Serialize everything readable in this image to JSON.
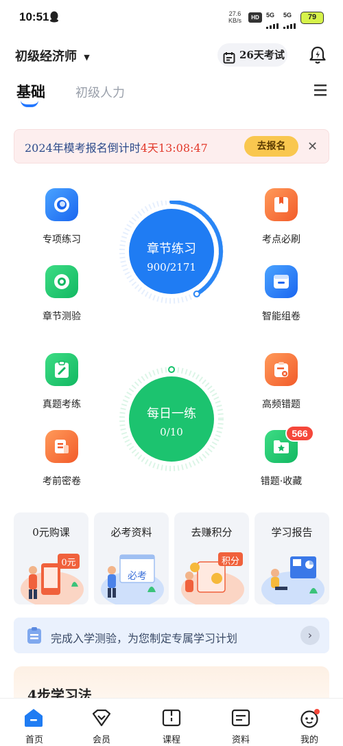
{
  "status_bar": {
    "time": "10:51",
    "net_speed_value": "27.6",
    "net_speed_unit": "KB/s",
    "signal1": "5G",
    "signal2": "5G",
    "battery": "79"
  },
  "header": {
    "exam_name": "初级经济师",
    "exam_days": "26天考试",
    "tabs": [
      "基础",
      "初级人力"
    ]
  },
  "banner": {
    "prefix": "2024年模考报名倒计时",
    "countdown": "4天13:08:47",
    "button": "去报名"
  },
  "features": {
    "left_top": [
      "专项练习",
      "章节测验"
    ],
    "right_top": [
      "考点必刷",
      "智能组卷"
    ],
    "left_bottom": [
      "真题考练",
      "考前密卷"
    ],
    "right_bottom": [
      "高频错题",
      "错题·收藏"
    ],
    "badge_count": "566"
  },
  "circles": {
    "chapter": {
      "title": "章节练习",
      "progress": "900/2171",
      "done": 900,
      "total": 2171
    },
    "daily": {
      "title": "每日一练",
      "progress": "0/10",
      "done": 0,
      "total": 10
    }
  },
  "cards": [
    {
      "title": "0元购课",
      "tag": "0元"
    },
    {
      "title": "必考资料",
      "tag": "必考"
    },
    {
      "title": "去赚积分",
      "tag": "积分"
    },
    {
      "title": "学习报告",
      "tag": ""
    }
  ],
  "assessment": {
    "text": "完成入学测验，为您制定专属学习计划"
  },
  "method": {
    "title": "4步学习法"
  },
  "nav": [
    "首页",
    "会员",
    "课程",
    "资料",
    "我的"
  ],
  "colors": {
    "accent": "#2277ff",
    "green": "#16c26c",
    "orange": "#f5692f",
    "red": "#e2392b"
  }
}
